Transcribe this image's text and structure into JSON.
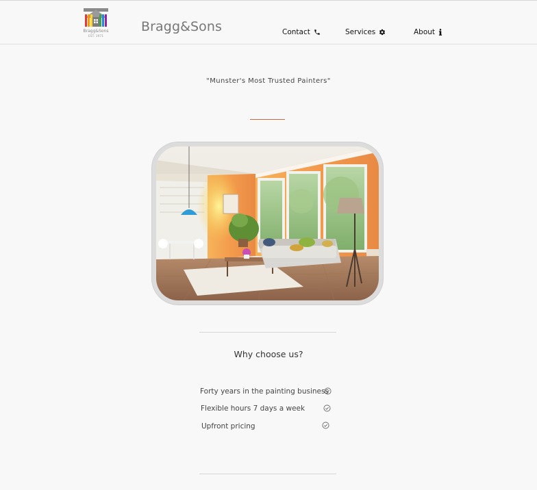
{
  "header": {
    "logo_text": "Bragg&Sons",
    "logo_est": "EST. 1971",
    "brand": "Bragg&Sons",
    "nav": [
      {
        "label": "Contact",
        "icon": "phone-icon"
      },
      {
        "label": "Services",
        "icon": "gear-icon"
      },
      {
        "label": "About",
        "icon": "info-icon"
      }
    ]
  },
  "hero": {
    "tagline": "\"Munster's Most Trusted Painters\""
  },
  "why": {
    "title": "Why choose us?",
    "items": [
      {
        "label": "Forty years in the painting business",
        "icon": "check-circle-icon"
      },
      {
        "label": "Flexible hours 7 days a week",
        "icon": "check-circle-icon"
      },
      {
        "label": "Upfront pricing",
        "icon": "check-circle-icon"
      }
    ]
  },
  "colors": {
    "accent": "#c96a3c",
    "background": "#f8f8f8",
    "brand_text": "#777777"
  }
}
